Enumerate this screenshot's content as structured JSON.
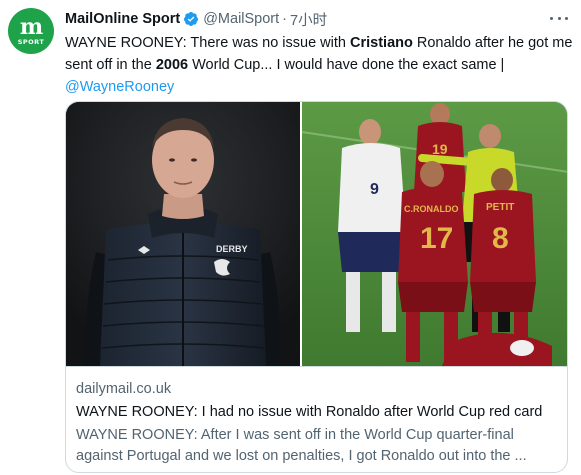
{
  "account": {
    "display_name": "MailOnline Sport",
    "handle": "@MailSport",
    "separator": "·",
    "time": "7小时",
    "avatar_letter": "m",
    "avatar_label": "SPORT",
    "avatar_color": "#1fa34a",
    "verified_icon": "verified-badge-icon"
  },
  "tweet": {
    "parts": [
      {
        "t": "WAYNE ROONEY: There was no issue with ",
        "b": false
      },
      {
        "t": "Cristiano",
        "b": true
      },
      {
        "t": " Ronaldo after he got me sent off in the ",
        "b": false
      },
      {
        "t": "2006",
        "b": true
      },
      {
        "t": " World Cup... I would have done the exact same | ",
        "b": false
      }
    ],
    "mention": "@WayneRooney"
  },
  "card": {
    "domain": "dailymail.co.uk",
    "title": "WAYNE ROONEY: I had no issue with Ronaldo after World Cup red card",
    "description": "WAYNE ROONEY: After I was sent off in the World Cup quarter-final against Portugal and we lost on penalties, I got Ronaldo out into the ...",
    "left_jersey_text": "DERBY",
    "right_jersey_numbers": {
      "england": "9",
      "ronaldo": "17",
      "petit": "8",
      "back": "19"
    },
    "right_jersey_names": {
      "ronaldo": "C.RONALDO",
      "petit": "PETIT"
    }
  },
  "colors": {
    "accent": "#1d9bf0",
    "pitch": "#4e8a3a",
    "portugal_red": "#9b1520",
    "referee_yellow": "#c8d92a"
  }
}
